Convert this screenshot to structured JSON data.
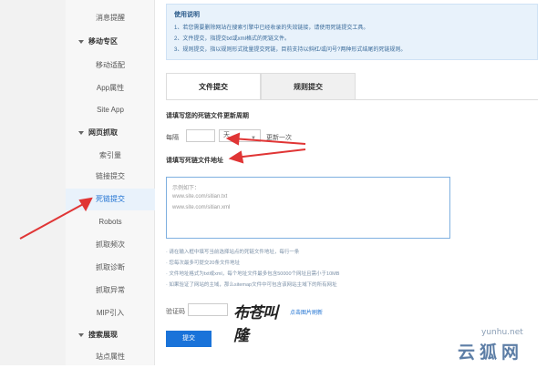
{
  "sidebar": {
    "items": [
      {
        "label": "消息提醒",
        "type": "item"
      },
      {
        "label": "移动专区",
        "type": "group"
      },
      {
        "label": "移动适配",
        "type": "item"
      },
      {
        "label": "App属性",
        "type": "item"
      },
      {
        "label": "Site App",
        "type": "item"
      },
      {
        "label": "网页抓取",
        "type": "group"
      },
      {
        "label": "索引量",
        "type": "item"
      },
      {
        "label": "链接提交",
        "type": "item"
      },
      {
        "label": "死链提交",
        "type": "item",
        "active": true
      },
      {
        "label": "Robots",
        "type": "item"
      },
      {
        "label": "抓取频次",
        "type": "item"
      },
      {
        "label": "抓取诊断",
        "type": "item"
      },
      {
        "label": "抓取异常",
        "type": "item"
      },
      {
        "label": "MIP引入",
        "type": "item"
      },
      {
        "label": "搜索展现",
        "type": "group"
      },
      {
        "label": "站点属性",
        "type": "item"
      }
    ]
  },
  "notice": {
    "title": "使用说明",
    "lines": [
      "1、若您需要删除网站在搜索引擎中已经收录的失效链接，请使用死链提交工具。",
      "2、文件提交，指提交txt或xml格式的死链文件。",
      "3、规则提交，指以规则形式批量提交死链，目前支持以斜杠/或问号?两种形式结尾的死链规则。"
    ]
  },
  "tabs": {
    "file": "文件提交",
    "rule": "规则提交"
  },
  "form": {
    "period_title": "请填写您的死链文件更新周期",
    "period_label": "每隔",
    "period_unit": "天",
    "period_suffix": "更新一次",
    "address_title": "请填写死链文件地址",
    "example_label": "示例如下：",
    "example_1": "www.site.com/sitian.txt",
    "example_2": "www.site.com/sitian.xml"
  },
  "hints": [
    "· 请在输入框中填写当前选择站点的死链文件地址，每行一条",
    "· 您每次最多可提交20条文件地址",
    "· 文件地址格式为txt或xml，每个地址文件最多包含50000个网址且需小于10MB",
    "· 如果验证了网站的主域，那么sitemap文件中可包含该网站主域下的所有网址"
  ],
  "captcha": {
    "label": "验证码",
    "image_text": "布苍叫隆",
    "refresh": "点击图片刷新"
  },
  "submit_label": "提交",
  "watermark": {
    "url": "yunhu.net",
    "logo": "云狐网"
  },
  "colors": {
    "accent": "#1a73d9",
    "arrow": "#e03535",
    "notice_bg": "#e8f2fb"
  }
}
